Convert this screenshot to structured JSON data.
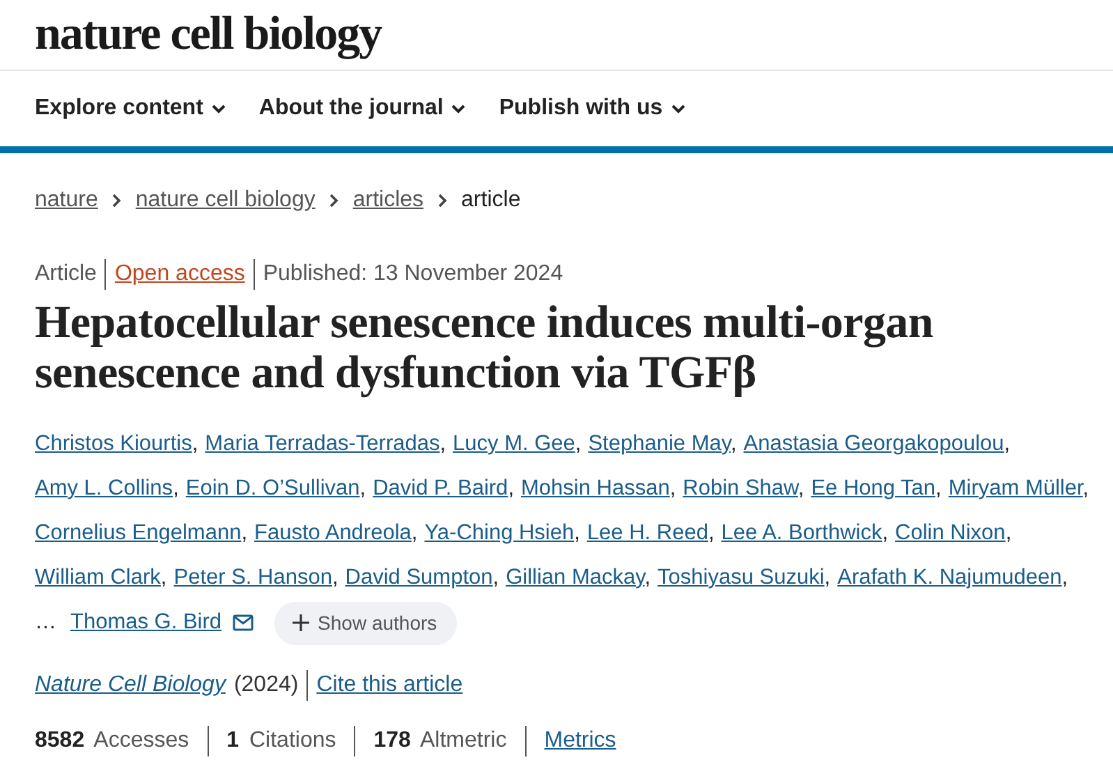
{
  "site": {
    "logo": "nature cell biology"
  },
  "nav": [
    {
      "label": "Explore content"
    },
    {
      "label": "About the journal"
    },
    {
      "label": "Publish with us"
    }
  ],
  "breadcrumb": [
    {
      "label": "nature",
      "link": true
    },
    {
      "label": "nature cell biology",
      "link": true
    },
    {
      "label": "articles",
      "link": true
    },
    {
      "label": "article",
      "link": false
    }
  ],
  "meta": {
    "type": "Article",
    "access": "Open access",
    "published": "Published: 13 November 2024"
  },
  "title": "Hepatocellular senescence induces multi-organ senescence and dysfunction via TGFβ",
  "authors": [
    {
      "name": "Christos Kiourtis",
      "separator": ","
    },
    {
      "name": "Maria Terradas-Terradas",
      "separator": ","
    },
    {
      "name": "Lucy M. Gee",
      "separator": ","
    },
    {
      "name": "Stephanie May",
      "separator": ","
    },
    {
      "name": "Anastasia Georgakopoulou",
      "separator": ","
    },
    {
      "name": "Amy L. Collins",
      "separator": ","
    },
    {
      "name": "Eoin D. O’Sullivan",
      "separator": ","
    },
    {
      "name": "David P. Baird",
      "separator": ","
    },
    {
      "name": "Mohsin Hassan",
      "separator": ","
    },
    {
      "name": "Robin Shaw",
      "separator": ","
    },
    {
      "name": "Ee Hong Tan",
      "separator": ","
    },
    {
      "name": "Miryam Müller",
      "separator": ","
    },
    {
      "name": "Cornelius Engelmann",
      "separator": ","
    },
    {
      "name": "Fausto Andreola",
      "separator": ","
    },
    {
      "name": "Ya-Ching Hsieh",
      "separator": ","
    },
    {
      "name": "Lee H. Reed",
      "separator": ","
    },
    {
      "name": "Lee A. Borthwick",
      "separator": ","
    },
    {
      "name": "Colin Nixon",
      "separator": ","
    },
    {
      "name": "William Clark",
      "separator": ","
    },
    {
      "name": "Peter S. Hanson",
      "separator": ","
    },
    {
      "name": "David Sumpton",
      "separator": ","
    },
    {
      "name": "Gillian Mackay",
      "separator": ","
    },
    {
      "name": "Toshiyasu Suzuki",
      "separator": ","
    },
    {
      "name": "Arafath K. Najumudeen",
      "separator": ","
    }
  ],
  "authors_ellipsis": "…",
  "corresponding_author": {
    "name": "Thomas G. Bird"
  },
  "show_authors_button": "Show authors",
  "citation": {
    "journal": "Nature Cell Biology",
    "year": "(2024)",
    "cite_link": "Cite this article"
  },
  "metrics": [
    {
      "count": "8582",
      "name": "Accesses"
    },
    {
      "count": "1",
      "name": "Citations"
    },
    {
      "count": "178",
      "name": "Altmetric"
    }
  ],
  "metrics_link": "Metrics"
}
